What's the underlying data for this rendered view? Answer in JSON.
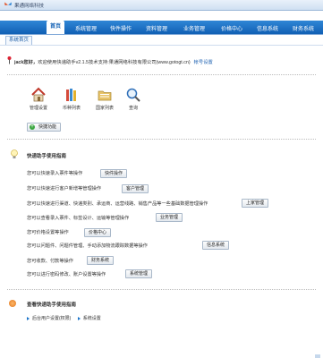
{
  "app": {
    "title": "果通网络科技",
    "logo_icon": "butterfly-logo-icon"
  },
  "menu": [
    {
      "label": "首页",
      "active": true
    },
    {
      "label": "系统管理",
      "active": false
    },
    {
      "label": "快件操作",
      "active": false
    },
    {
      "label": "资料管理",
      "active": false
    },
    {
      "label": "业务管理",
      "active": false
    },
    {
      "label": "价格中心",
      "active": false
    },
    {
      "label": "信息系统",
      "active": false
    },
    {
      "label": "财务系统",
      "active": false
    }
  ],
  "tab": {
    "label": "系统首页"
  },
  "welcome": {
    "user": "jack您好，",
    "text": "欢迎使用快递助手v2.1.5技术支持:果通网络科技有限公司(www.gotogt.cn)",
    "link": "帐号设置"
  },
  "quick_icons": [
    {
      "label": "管理设置",
      "icon": "house-icon"
    },
    {
      "label": "币种列表",
      "icon": "books-icon"
    },
    {
      "label": "国家列表",
      "icon": "folder-icon"
    },
    {
      "label": "查询",
      "icon": "magnifier-icon"
    }
  ],
  "quick_button": "快捷功能",
  "guide": {
    "title": "快递助手使用指南",
    "lines": [
      {
        "text": "您可以快速录入票件等操作",
        "button": "快件操作"
      },
      {
        "text": "您可以快速进行客户新增等管理操作",
        "button": "客户管理"
      },
      {
        "text": "您可以快速进行渠道、快递类别、承运商、运营线路、销售产品等一些基础数据管理操作",
        "button": "上家管理"
      },
      {
        "text": "您可以查看录入票件、标签设计、运输等管理操作",
        "button": "业务管理"
      },
      {
        "text": "您可价格设置等操作",
        "button": "价格中心"
      },
      {
        "text": "您可以问题件、问题件管理、手动添加物流跟踪数据等操作",
        "button": "信息系统"
      },
      {
        "text": "您可收款、付款等操作",
        "button": "财务系统"
      },
      {
        "text": "您可以进行密码修改、账户设置等操作",
        "button": "系统管理"
      }
    ]
  },
  "view_guide": {
    "title": "查看快递助手使用指南",
    "items": [
      "后台用户设置(权限)",
      "系统设置"
    ]
  }
}
